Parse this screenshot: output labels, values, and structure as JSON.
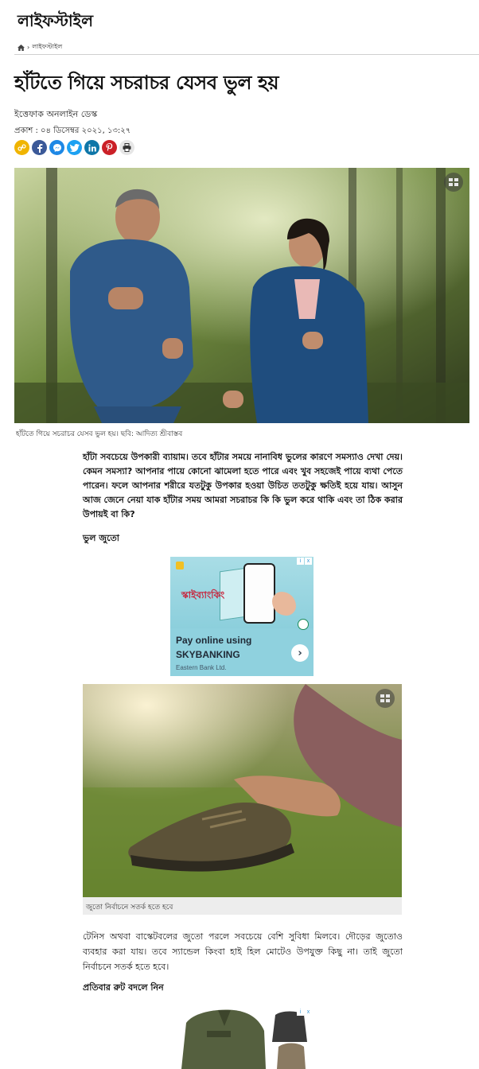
{
  "section": {
    "title": "লাইফস্টাইল"
  },
  "breadcrumb": {
    "home_icon": "home-icon",
    "separator": "›",
    "current": "লাইফস্টাইল"
  },
  "article": {
    "headline": "হাঁটতে গিয়ে সচরাচর যেসব ভুল হয়",
    "author": "ইত্তেফাক অনলাইন ডেস্ক",
    "published": "প্রকাশ : ০৪ ডিসেম্বর ২০২১, ১৩:২৭",
    "hero_caption": "হাঁটতে গিয়ে সচরাচর যেসব ভুল হয়। ছবি: আদিত্য শ্রীবাস্তব",
    "lead": "হাঁটা সবচেয়ে উপকারী ব্যায়াম। তবে হাঁটার সময়ে নানাবিধ ভুলের কারণে সমস্যাও দেখা দেয়। কেমন সমস্যা? আপনার পায়ে কোনো ঝামেলা হতে পারে এবং খুব সহজেই পায়ে ব্যথা পেতে পারেন। ফলে আপনার শরীরে যতটুকু উপকার হওয়া উচিত ততটুকু ক্ষতিই হয়ে যায়। আসুন আজ জেনে নেয়া যাক হাঁটার সময় আমরা সচরাচর কি কি ভুল করে থাকি এবং তা ঠিক করার উপায়ই বা কি?",
    "subhead1": "ভুল জুতো",
    "photo2_caption": "জুতো নির্বাচনে সতর্ক হতে হবে",
    "body2": "টেনিস অথবা বাস্কেটবলের জুতো পরলে সবচেয়ে বেশি সুবিধা মিলবে। দৌড়ের জুতোও ব্যবহার করা যায়। তবে স্যান্ডেল কিংবা হাই হিল মোটেও উপযুক্ত কিছু না। তাই জুতো নির্বাচনে সতর্ক হতে হবে।",
    "subhead2": "প্রতিবার রুট বদলে নিন"
  },
  "share": [
    {
      "icon": "link-icon",
      "glyph": "🔗",
      "color": "#f0b400"
    },
    {
      "icon": "facebook-icon",
      "glyph": "f",
      "color": "#3b5998"
    },
    {
      "icon": "messenger-icon",
      "glyph": "m",
      "color": "#1e88e5"
    },
    {
      "icon": "twitter-icon",
      "glyph": "t",
      "color": "#1da1f2"
    },
    {
      "icon": "linkedin-icon",
      "glyph": "in",
      "color": "#0e76a8"
    },
    {
      "icon": "pinterest-icon",
      "glyph": "p",
      "color": "#cb2027"
    },
    {
      "icon": "print-icon",
      "glyph": "⎙",
      "color": "#e6e6e6"
    }
  ],
  "ad1": {
    "banner_text": "স্কাইব্যাংকিং",
    "cta_line1": "Pay online using",
    "cta_line2": "SKYBANKING",
    "advertiser": "Eastern Bank Ltd.",
    "arrow": "›",
    "info": "i",
    "close": "x"
  },
  "ad2": {
    "info": "i",
    "close": "x"
  }
}
